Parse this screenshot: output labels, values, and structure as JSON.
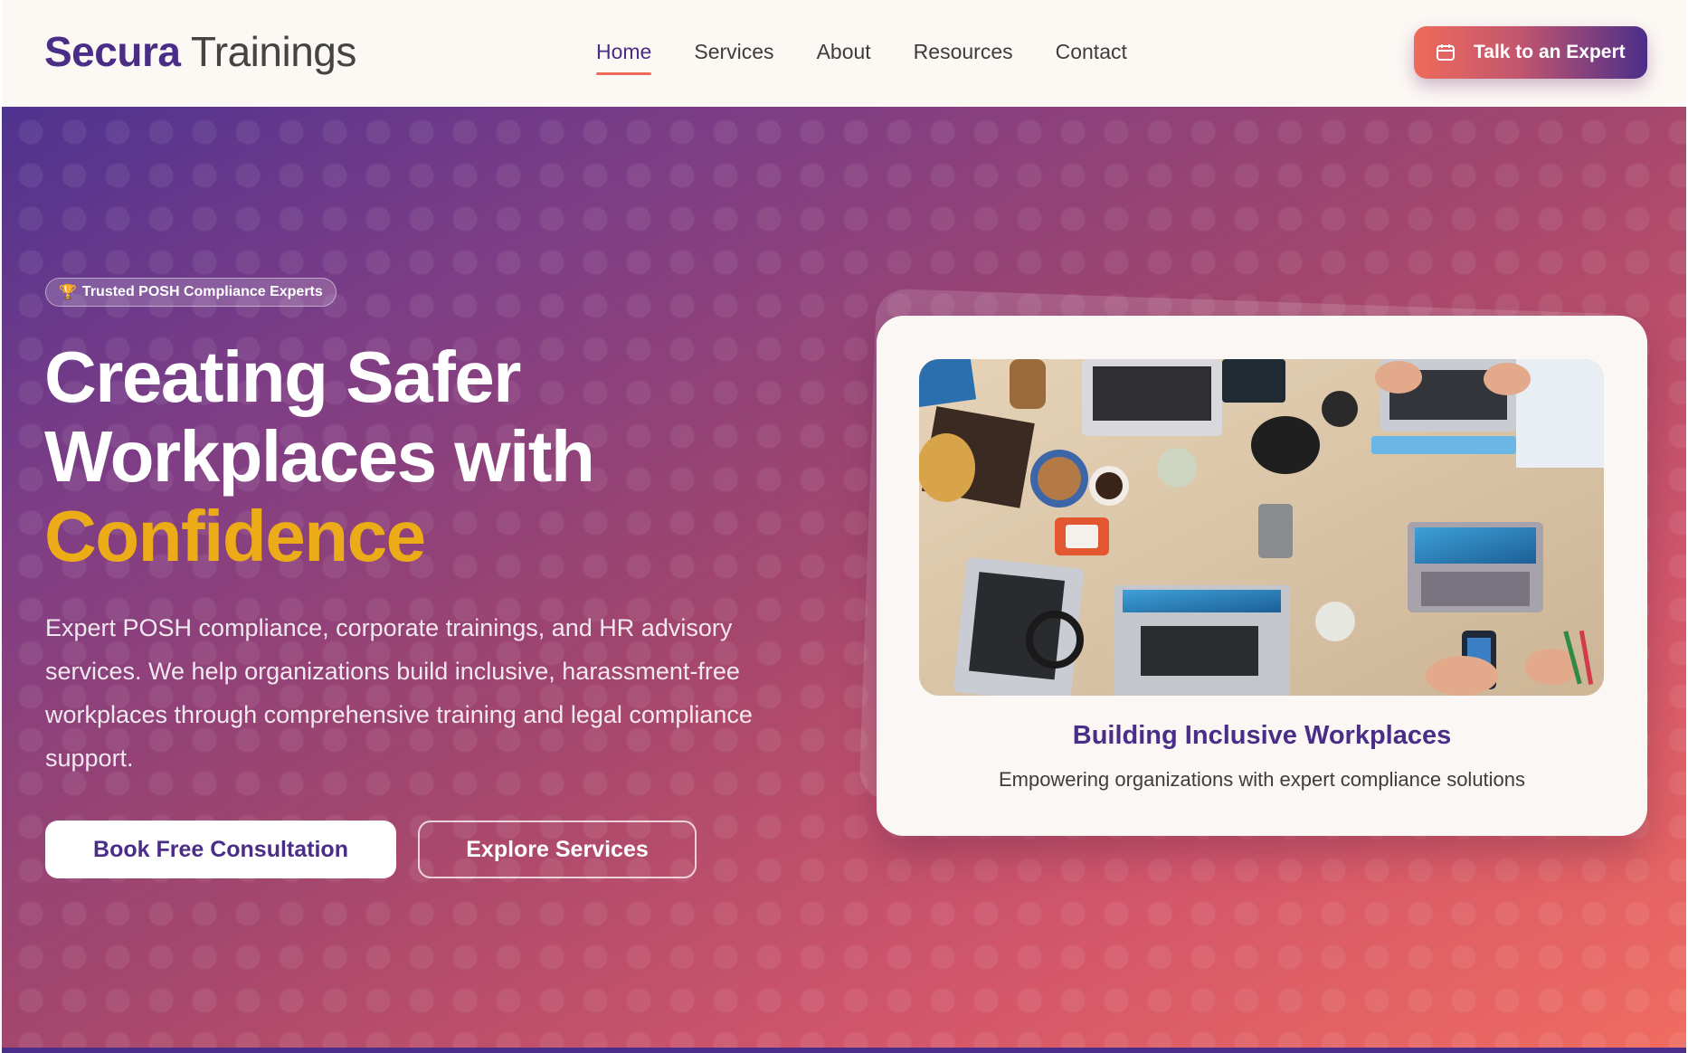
{
  "brand": {
    "bold": "Secura",
    "light": " Trainings"
  },
  "nav": {
    "links": [
      "Home",
      "Services",
      "About",
      "Resources",
      "Contact"
    ],
    "active": "Home",
    "cta_label": "Talk to an Expert",
    "cta_icon": "calendar-icon"
  },
  "hero": {
    "badge_icon": "trophy-icon",
    "badge": "Trusted POSH Compliance Experts",
    "title_line1": "Creating Safer",
    "title_line2": "Workplaces with",
    "title_highlight": "Confidence",
    "description": "Expert POSH compliance, corporate trainings, and HR advisory services. We help organizations build inclusive, harassment-free workplaces through comprehensive training and legal compliance support.",
    "primary_button": "Book Free Consultation",
    "secondary_button": "Explore Services"
  },
  "card": {
    "image": "overhead-desk-with-laptops-photo",
    "title": "Building Inclusive Workplaces",
    "subtitle": "Empowering organizations with expert compliance solutions"
  },
  "colors": {
    "brand_purple": "#4a2d86",
    "accent_coral": "#f06a5a",
    "highlight_gold": "#ecac17",
    "nav_bg": "#fcf8f4"
  }
}
